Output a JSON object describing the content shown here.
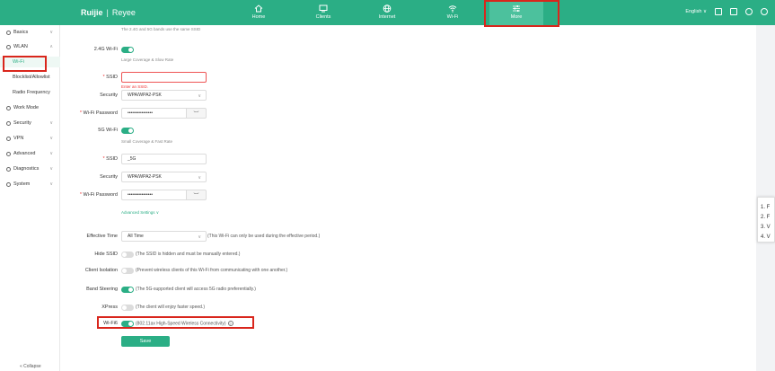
{
  "brand": {
    "logo": "Ruijie",
    "sep": "|",
    "sub": "Reyee"
  },
  "nav": [
    {
      "label": "Home",
      "icon": "home-icon"
    },
    {
      "label": "Clients",
      "icon": "clients-icon"
    },
    {
      "label": "Internet",
      "icon": "globe-icon"
    },
    {
      "label": "Wi-Fi",
      "icon": "wifi-icon"
    },
    {
      "label": "More",
      "icon": "sliders-icon"
    }
  ],
  "topright": {
    "language": "English"
  },
  "sidebar": {
    "items": [
      {
        "label": "Basics"
      },
      {
        "label": "WLAN"
      },
      {
        "label": "Wi-Fi"
      },
      {
        "label": "Blocklist/Allowlist"
      },
      {
        "label": "Radio Frequency"
      },
      {
        "label": "Work Mode"
      },
      {
        "label": "Security"
      },
      {
        "label": "VPN"
      },
      {
        "label": "Advanced"
      },
      {
        "label": "Diagnostics"
      },
      {
        "label": "System"
      }
    ],
    "collapse": "« Collapse"
  },
  "form": {
    "top_hint": "The 2.4G and 5G bands use the same SSID",
    "wifi24": {
      "label": "2.4G Wi-Fi",
      "hint": "Large Coverage & Slow Rate"
    },
    "ssid24": {
      "label": "SSID",
      "value": "",
      "error": "Enter an SSID."
    },
    "security24": {
      "label": "Security",
      "value": "WPA/WPA2-PSK"
    },
    "pwd24": {
      "label": "Wi-Fi Password",
      "value": "••••••••••••••••"
    },
    "wifi5": {
      "label": "5G Wi-Fi",
      "hint": "Small Coverage & Fast Rate"
    },
    "ssid5": {
      "label": "SSID",
      "value": "_5G"
    },
    "security5": {
      "label": "Security",
      "value": "WPA/WPA2-PSK"
    },
    "pwd5": {
      "label": "Wi-Fi Password",
      "value": "••••••••••••••••"
    },
    "advanced": "Advanced Settings ∨",
    "effective_time": {
      "label": "Effective Time",
      "value": "All Time",
      "note": "(This Wi-Fi can only be used during the effective period.)"
    },
    "hide_ssid": {
      "label": "Hide SSID",
      "note": "(The SSID is hidden and must be manually entered.)"
    },
    "client_isolation": {
      "label": "Client Isolation",
      "note": "(Prevent wireless clients of this Wi-Fi from communicating with one another.)"
    },
    "band_steering": {
      "label": "Band Steering",
      "note": "(The 5G-supported client will access 5G radio preferentially.)"
    },
    "xpress": {
      "label": "XPress",
      "note": "(The client will enjoy faster speed.)"
    },
    "wifi6": {
      "label": "Wi-Fi6",
      "note": "(802.11ax High-Speed Wireless Connectivity)",
      "help": "?"
    },
    "save": "Save"
  },
  "popup": [
    "1. F",
    "2. F",
    "3. V",
    "4. V"
  ],
  "colors": {
    "accent": "#2bae85",
    "highlight": "#d9261c"
  }
}
